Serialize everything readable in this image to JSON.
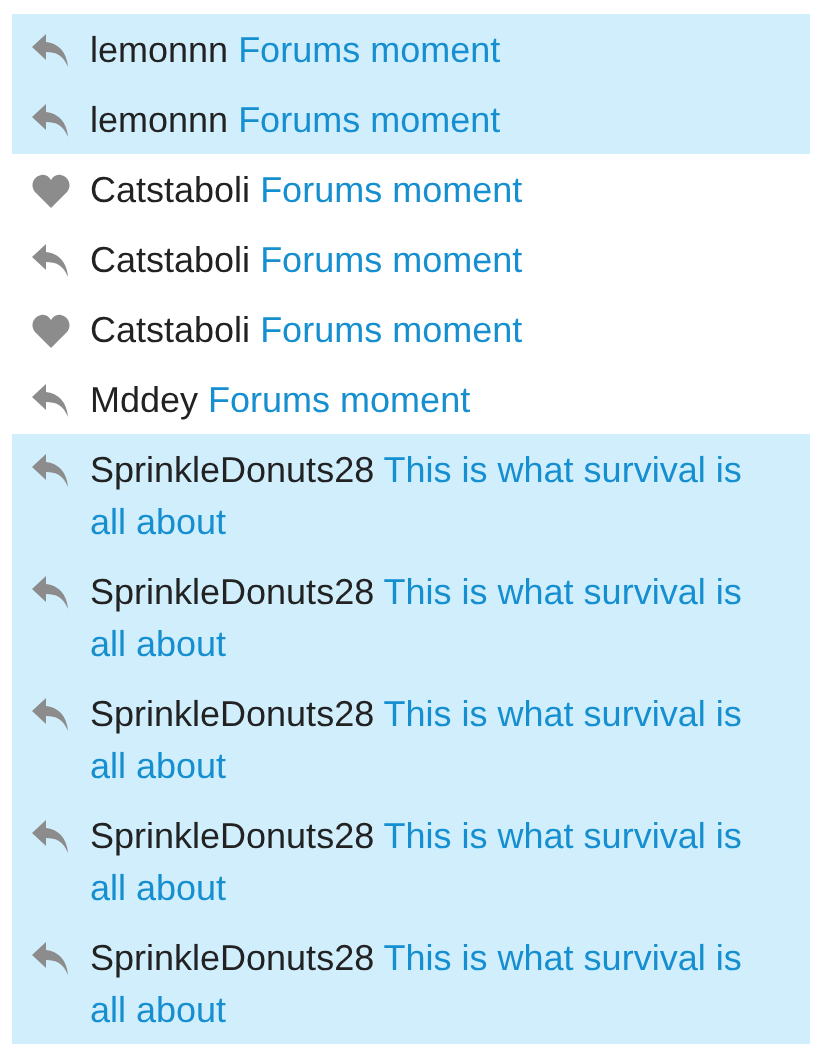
{
  "notifications": [
    {
      "kind": "reply",
      "user": "lemonnn",
      "title": "Forums moment",
      "unread": true
    },
    {
      "kind": "reply",
      "user": "lemonnn",
      "title": "Forums moment",
      "unread": true
    },
    {
      "kind": "like",
      "user": "Catstaboli",
      "title": "Forums moment",
      "unread": false
    },
    {
      "kind": "reply",
      "user": "Catstaboli",
      "title": "Forums moment",
      "unread": false
    },
    {
      "kind": "like",
      "user": "Catstaboli",
      "title": "Forums moment",
      "unread": false
    },
    {
      "kind": "reply",
      "user": "Mddey",
      "title": "Forums moment",
      "unread": false
    },
    {
      "kind": "reply",
      "user": "SprinkleDonuts28",
      "title": "This is what survival is all about",
      "unread": true
    },
    {
      "kind": "reply",
      "user": "SprinkleDonuts28",
      "title": "This is what survival is all about",
      "unread": true
    },
    {
      "kind": "reply",
      "user": "SprinkleDonuts28",
      "title": "This is what survival is all about",
      "unread": true
    },
    {
      "kind": "reply",
      "user": "SprinkleDonuts28",
      "title": "This is what survival is all about",
      "unread": true
    },
    {
      "kind": "reply",
      "user": "SprinkleDonuts28",
      "title": "This is what survival is all about",
      "unread": true
    }
  ]
}
